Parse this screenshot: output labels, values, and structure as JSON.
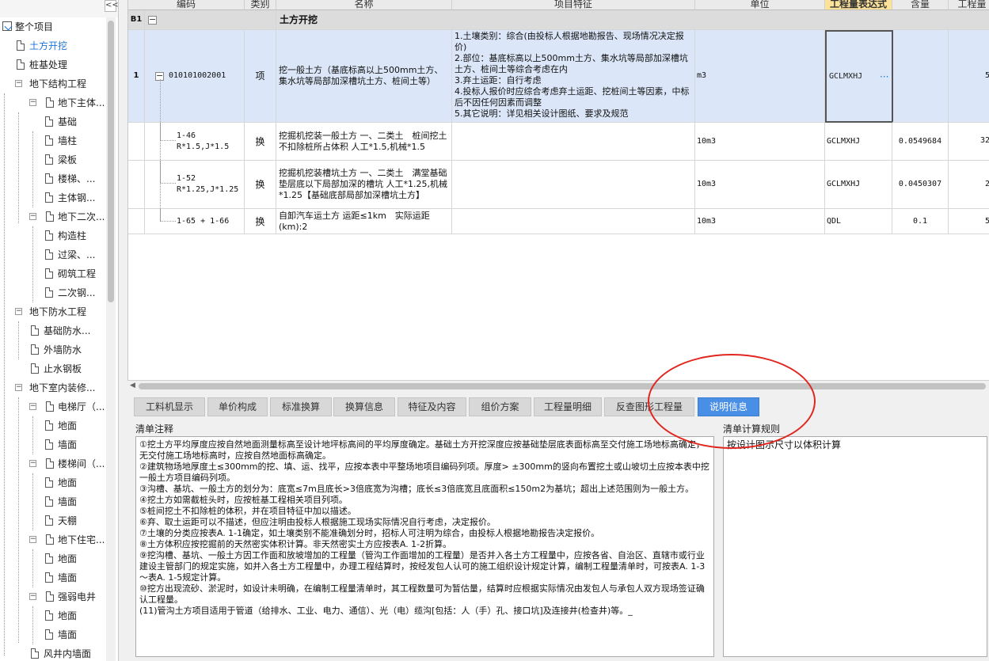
{
  "tree": {
    "collapse_label": "<<",
    "items": [
      {
        "label": "整个项目",
        "level": 0,
        "kind": "root",
        "expander": ""
      },
      {
        "label": "土方开挖",
        "level": 1,
        "kind": "doc",
        "expander": "",
        "selected": true
      },
      {
        "label": "桩基处理",
        "level": 1,
        "kind": "doc",
        "expander": ""
      },
      {
        "label": "地下结构工程",
        "level": 1,
        "kind": "folder",
        "expander": "−"
      },
      {
        "label": "地下主体...",
        "level": 2,
        "kind": "doc",
        "expander": "−"
      },
      {
        "label": "基础",
        "level": 3,
        "kind": "doc",
        "expander": ""
      },
      {
        "label": "墙柱",
        "level": 3,
        "kind": "doc",
        "expander": ""
      },
      {
        "label": "梁板",
        "level": 3,
        "kind": "doc",
        "expander": ""
      },
      {
        "label": "楼梯、...",
        "level": 3,
        "kind": "doc",
        "expander": ""
      },
      {
        "label": "主体钢...",
        "level": 3,
        "kind": "doc",
        "expander": ""
      },
      {
        "label": "地下二次...",
        "level": 2,
        "kind": "doc",
        "expander": "−"
      },
      {
        "label": "构造柱",
        "level": 3,
        "kind": "doc",
        "expander": ""
      },
      {
        "label": "过梁、...",
        "level": 3,
        "kind": "doc",
        "expander": ""
      },
      {
        "label": "砌筑工程",
        "level": 3,
        "kind": "doc",
        "expander": ""
      },
      {
        "label": "二次钢...",
        "level": 3,
        "kind": "doc",
        "expander": ""
      },
      {
        "label": "地下防水工程",
        "level": 1,
        "kind": "folder",
        "expander": "−"
      },
      {
        "label": "基础防水...",
        "level": 2,
        "kind": "doc",
        "expander": ""
      },
      {
        "label": "外墙防水",
        "level": 2,
        "kind": "doc",
        "expander": ""
      },
      {
        "label": "止水钢板",
        "level": 2,
        "kind": "doc",
        "expander": ""
      },
      {
        "label": "地下室内装修...",
        "level": 1,
        "kind": "folder",
        "expander": "−"
      },
      {
        "label": "电梯厅（...",
        "level": 2,
        "kind": "doc",
        "expander": "−"
      },
      {
        "label": "地面",
        "level": 3,
        "kind": "doc",
        "expander": ""
      },
      {
        "label": "墙面",
        "level": 3,
        "kind": "doc",
        "expander": ""
      },
      {
        "label": "楼梯间（...",
        "level": 2,
        "kind": "doc",
        "expander": "−"
      },
      {
        "label": "地面",
        "level": 3,
        "kind": "doc",
        "expander": ""
      },
      {
        "label": "墙面",
        "level": 3,
        "kind": "doc",
        "expander": ""
      },
      {
        "label": "天棚",
        "level": 3,
        "kind": "doc",
        "expander": ""
      },
      {
        "label": "地下住宅...",
        "level": 2,
        "kind": "doc",
        "expander": "−"
      },
      {
        "label": "地面",
        "level": 3,
        "kind": "doc",
        "expander": ""
      },
      {
        "label": "墙面",
        "level": 3,
        "kind": "doc",
        "expander": ""
      },
      {
        "label": "强弱电井",
        "level": 2,
        "kind": "doc",
        "expander": "−"
      },
      {
        "label": "地面",
        "level": 3,
        "kind": "doc",
        "expander": ""
      },
      {
        "label": "墙面",
        "level": 3,
        "kind": "doc",
        "expander": ""
      },
      {
        "label": "风井内墙面",
        "level": 2,
        "kind": "doc",
        "expander": ""
      }
    ]
  },
  "grid": {
    "headers": [
      "编码",
      "类别",
      "名称",
      "项目特征",
      "单位",
      "工程量表达式",
      "含量",
      "工程量"
    ],
    "section": {
      "no": "B1",
      "expander": "−",
      "name": "土方开挖"
    },
    "main_row": {
      "no": "1",
      "expander": "−",
      "code": "010101002001",
      "category": "项",
      "name": "挖一般土方（基底标高以上500mm土方、集水坑等局部加深槽坑土方、桩间土等）",
      "features": [
        "1.土壤类别：综合(由投标人根据地勘报告、现场情况决定报价)",
        "2.部位：基底标高以上500mm土方、集水坑等局部加深槽坑土方、桩间土等综合考虑在内",
        "3.弃土运距：自行考虑",
        "4.投标人报价时应综合考虑弃土运距、挖桩间土等因素，中标后不因任何因素而调整",
        "5.其它说明：详见相关设计图纸、要求及规范"
      ],
      "unit": "m3",
      "expr": "GCLMXHJ",
      "expr_btn": "···",
      "content": "",
      "qty": "5"
    },
    "sub_rows": [
      {
        "code": [
          "1-46",
          "R*1.5,J*1.5"
        ],
        "category": "换",
        "name": "挖掘机挖装一般土方 一、二类土　桩间挖土不扣除桩所占体积 人工*1.5,机械*1.5",
        "features": "",
        "unit": "10m3",
        "expr": "GCLMXHJ",
        "content": "0.0549684",
        "qty": "32"
      },
      {
        "code": [
          "1-52",
          "R*1.25,J*1.25"
        ],
        "category": "换",
        "name": "挖掘机挖装槽坑土方 一、二类土　满堂基础垫层底以下局部加深的槽坑 人工*1.25,机械*1.25【基础底部局部加深槽坑土方】",
        "features": "",
        "unit": "10m3",
        "expr": "GCLMXHJ",
        "content": "0.0450307",
        "qty": "2"
      },
      {
        "code": [
          "1-65 + 1-66"
        ],
        "category": "换",
        "name": "自卸汽车运土方 运距≤1km　实际运距(km):2",
        "features": "",
        "unit": "10m3",
        "expr": "QDL",
        "content": "0.1",
        "qty": "5"
      }
    ]
  },
  "scroll_arrow": "◀",
  "tabs": [
    {
      "label": "工料机显示",
      "active": false
    },
    {
      "label": "单价构成",
      "active": false
    },
    {
      "label": "标准换算",
      "active": false
    },
    {
      "label": "换算信息",
      "active": false
    },
    {
      "label": "特征及内容",
      "active": false
    },
    {
      "label": "组价方案",
      "active": false
    },
    {
      "label": "工程量明细",
      "active": false
    },
    {
      "label": "反查图形工程量",
      "active": false
    },
    {
      "label": "说明信息",
      "active": true
    }
  ],
  "notes_pane": {
    "title": "清单注释",
    "lines": [
      "①挖土方平均厚度应按自然地面测量标高至设计地坪标高间的平均厚度确定。基础土方开挖深度应按基础垫层底表面标高至交付施工场地标高确定，无交付施工场地标高时，应按自然地面标高确定。",
      "②建筑物场地厚度土≤300mm的挖、填、运、找平，应按本表中平整场地项目编码列项。厚度> ±300mm的竖向布置挖土或山坡切土应按本表中挖一般土方项目编码列项。",
      "③沟槽、基坑、一般土方的划分为：底宽≤7m且底长>3倍底宽为沟槽；底长≤3倍底宽且底面积≤150m2为基坑；超出上述范围则为一般土方。",
      "④挖土方如需截桩头时，应按桩基工程相关项目列项。",
      "⑤桩间挖土不扣除桩的体积，并在项目特征中加以描述。",
      "⑥弃、取土运距可以不描述，但应注明由投标人根据施工现场实际情况自行考虑，决定报价。",
      "⑦土壤的分类应按表A. 1-1确定，如土壤类别不能准确划分时，招标人可注明为综合，由投标人根据地勘报告决定报价。",
      "⑧土方体积应按挖掘前的天然密实体积计算。非天然密实土方应按表A. 1-2折算。",
      "⑨挖沟槽、基坑、一般土方因工作面和放坡增加的工程量（管沟工作面增加的工程量）是否并入各土方工程量中，应按各省、自治区、直辖市或行业建设主管部门的规定实施，如并入各土方工程量中，办理工程结算时，按经发包人认可的施工组织设计规定计算，编制工程量清单时，可按表A. 1-3～表A. 1-5规定计算。",
      "⑩挖方出现流砂、淤泥时，如设计未明确，在编制工程量清单时，其工程数量可为暂估量，结算时应根据实际情况由发包人与承包人双方现场签证确认工程量。",
      "(11)管沟土方项目适用于管道（给排水、工业、电力、通信）、光（电）缆沟[包括：人（手）孔、接口坑]及连接井(检查井)等。_"
    ]
  },
  "rules_pane": {
    "title": "清单计算规则",
    "text": "按设计图示尺寸以体积计算"
  },
  "colors": {
    "accent": "#4a8fe6",
    "selected_row": "#dbe7f8",
    "expr_header": "#fde39a",
    "annotation": "#e0261f"
  }
}
